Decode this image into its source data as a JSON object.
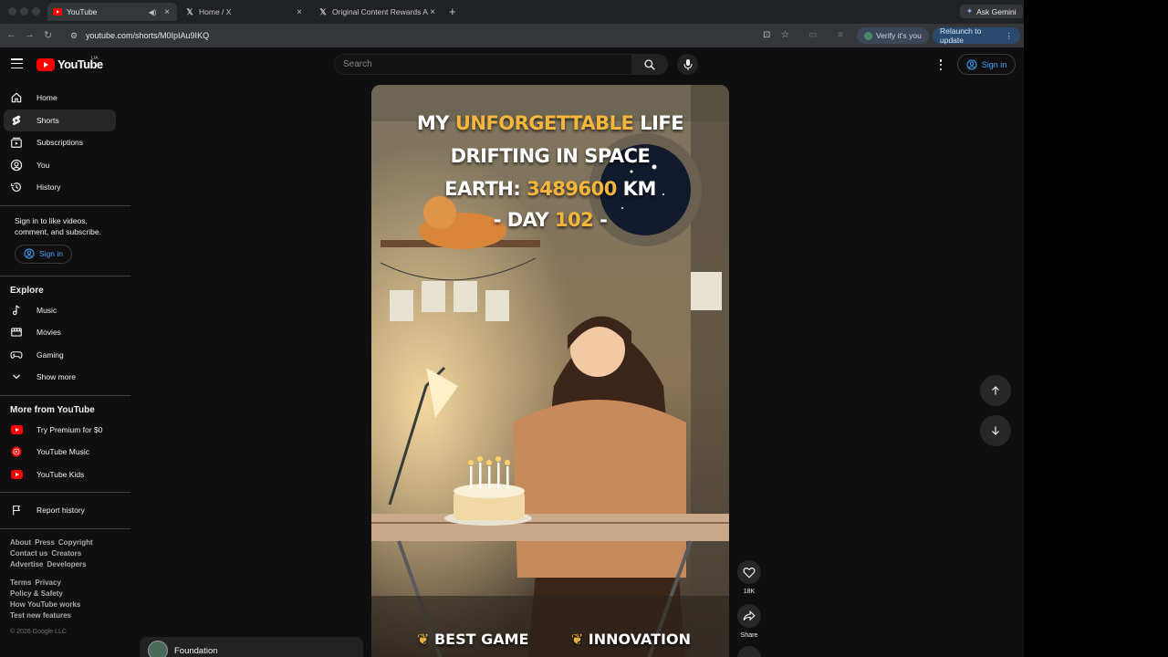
{
  "browser": {
    "tabs": [
      {
        "title": "YouTube",
        "icon": "youtube-favicon",
        "active": true
      },
      {
        "title": "Home / X",
        "icon": "x-favicon",
        "active": false
      },
      {
        "title": "Original Content Rewards Ap",
        "icon": "x-favicon",
        "active": false
      }
    ],
    "new_tab": "+",
    "ask_gemini": "Ask Gemini",
    "url": "youtube.com/shorts/M0IpIAu9IKQ",
    "verify": "Verify it's you",
    "relaunch": "Relaunch to update"
  },
  "header": {
    "logo_text": "YouTube",
    "country_code": "UA",
    "search_placeholder": "Search",
    "sign_in": "Sign in"
  },
  "sidebar": {
    "main": [
      {
        "label": "Home",
        "icon": "home-icon",
        "active": false
      },
      {
        "label": "Shorts",
        "icon": "shorts-icon",
        "active": true
      },
      {
        "label": "Subscriptions",
        "icon": "subscriptions-icon",
        "active": false
      },
      {
        "label": "You",
        "icon": "you-icon",
        "active": false
      },
      {
        "label": "History",
        "icon": "history-icon",
        "active": false
      }
    ],
    "signin_prompt": "Sign in to like videos, comment, and subscribe.",
    "signin_button": "Sign in",
    "explore_title": "Explore",
    "explore": [
      {
        "label": "Music",
        "icon": "music-icon"
      },
      {
        "label": "Movies",
        "icon": "movies-icon"
      },
      {
        "label": "Gaming",
        "icon": "gaming-icon"
      },
      {
        "label": "Show more",
        "icon": "chevron-down-icon"
      }
    ],
    "more_title": "More from YouTube",
    "more": [
      {
        "label": "Try Premium for $0",
        "icon": "youtube-premium-icon"
      },
      {
        "label": "YouTube Music",
        "icon": "youtube-music-icon"
      },
      {
        "label": "YouTube Kids",
        "icon": "youtube-kids-icon"
      }
    ],
    "report": "Report history",
    "footer_rows": [
      [
        "About",
        "Press",
        "Copyright"
      ],
      [
        "Contact us",
        "Creators"
      ],
      [
        "Advertise",
        "Developers"
      ],
      [
        "Terms",
        "Privacy"
      ],
      [
        "Policy & Safety"
      ],
      [
        "How YouTube works"
      ],
      [
        "Test new features"
      ]
    ],
    "copyright": "© 2026 Google LLC"
  },
  "short": {
    "title_line1_a": "MY ",
    "title_line1_b": "UNFORGETTABLE",
    "title_line1_c": " LIFE",
    "title_line2": "DRIFTING IN SPACE",
    "title_line3_a": "EARTH: ",
    "title_line3_b": "3489600",
    "title_line3_c": " KM",
    "title_line4_a": "- DAY ",
    "title_line4_b": "102",
    "title_line4_c": " -",
    "badge1": "BEST GAME",
    "badge2": "INNOVATION",
    "likes": "18K",
    "share": "Share",
    "channel": "Foundation"
  }
}
